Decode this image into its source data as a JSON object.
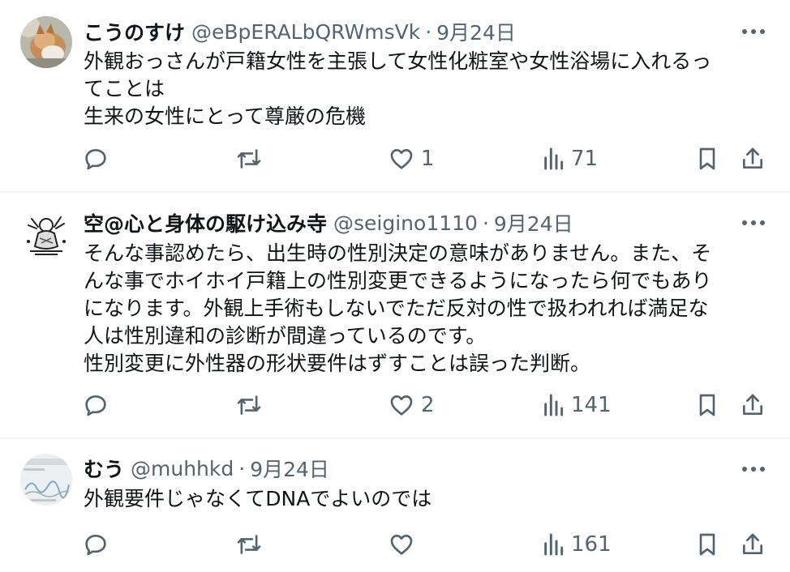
{
  "colors": {
    "text": "#0f1419",
    "secondary": "#536471",
    "divider": "#eff3f4"
  },
  "tweets": [
    {
      "name": "こうのすけ",
      "handle": "@eBpERALbQRWmsVk",
      "separator": "·",
      "date": "9月24日",
      "lines": [
        "外観おっさんが戸籍女性を主張して女性化粧室や女性浴場に入れるっ",
        "てことは",
        "生来の女性にとって尊厳の危機"
      ],
      "replies": "",
      "reposts": "",
      "likes": "1",
      "views": "71",
      "avatar_icon": "cat-photo"
    },
    {
      "name": "空@心と身体の駆け込み寺",
      "handle": "@seigino1110",
      "separator": "·",
      "date": "9月24日",
      "lines": [
        "そんな事認めたら、出生時の性別決定の意味がありません。また、そ",
        "んな事でホイホイ戸籍上の性別変更できるようになったら何でもあり",
        "になります。外観上手術もしないでただ反対の性で扱われれば満足な",
        "人は性別違和の診断が間違っているのです。",
        "性別変更に外性器の形状要件はずすことは誤った判断。"
      ],
      "replies": "",
      "reposts": "",
      "likes": "2",
      "views": "141",
      "avatar_icon": "sketch-drawing"
    },
    {
      "name": "むう",
      "handle": "@muhhkd",
      "separator": "·",
      "date": "9月24日",
      "lines": [
        "外観要件じゃなくてDNAでよいのでは"
      ],
      "replies": "",
      "reposts": "",
      "likes": "",
      "views": "161",
      "avatar_icon": "screenshot-thumbnail"
    }
  ]
}
